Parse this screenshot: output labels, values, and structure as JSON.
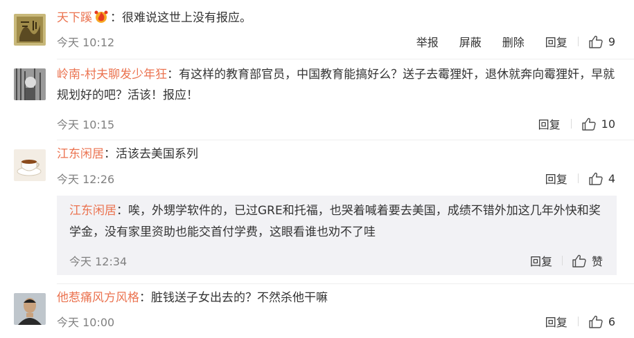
{
  "comments": [
    {
      "username": "天下蹊",
      "text": "：很难说这世上没有报应。",
      "time": "今天 10:12",
      "actions": [
        "举报",
        "屏蔽",
        "删除",
        "回复"
      ],
      "likes": "9"
    },
    {
      "username": "岭南-村夫聊发少年狂",
      "text": "：有这样的教育部官员，中国教育能搞好么？送子去霉狸奸，退休就奔向霉狸奸，早就规划好的吧？活该！报应！",
      "time": "今天 10:15",
      "reply_label": "回复",
      "likes": "10"
    },
    {
      "username": "江东闲居",
      "text": "：活该去美国系列",
      "time": "今天 12:26",
      "reply_label": "回复",
      "likes": "4"
    },
    {
      "username": "他惹痛风方风格",
      "text": "：脏钱送子女出去的？不然杀他干嘛",
      "time": "今天 10:00",
      "reply_label": "回复",
      "likes": "6"
    }
  ],
  "nested_reply": {
    "username": "江东闲居",
    "text": "：唉，外甥学软件的，已过GRE和托福，也哭着喊着要去美国，成绩不错外加这几年外快和奖学金，没有家里资助也能交首付学费，这眼看谁也劝不了哇",
    "time": "今天 12:34",
    "reply_label": "回复",
    "like_label": "赞"
  },
  "colors": {
    "username": "#eb7350",
    "meta": "#808080",
    "text": "#333333",
    "reply_bg": "#f2f2f5"
  },
  "icons": {
    "like": "thumbs-up-icon",
    "badge": "fire-badge-icon"
  }
}
